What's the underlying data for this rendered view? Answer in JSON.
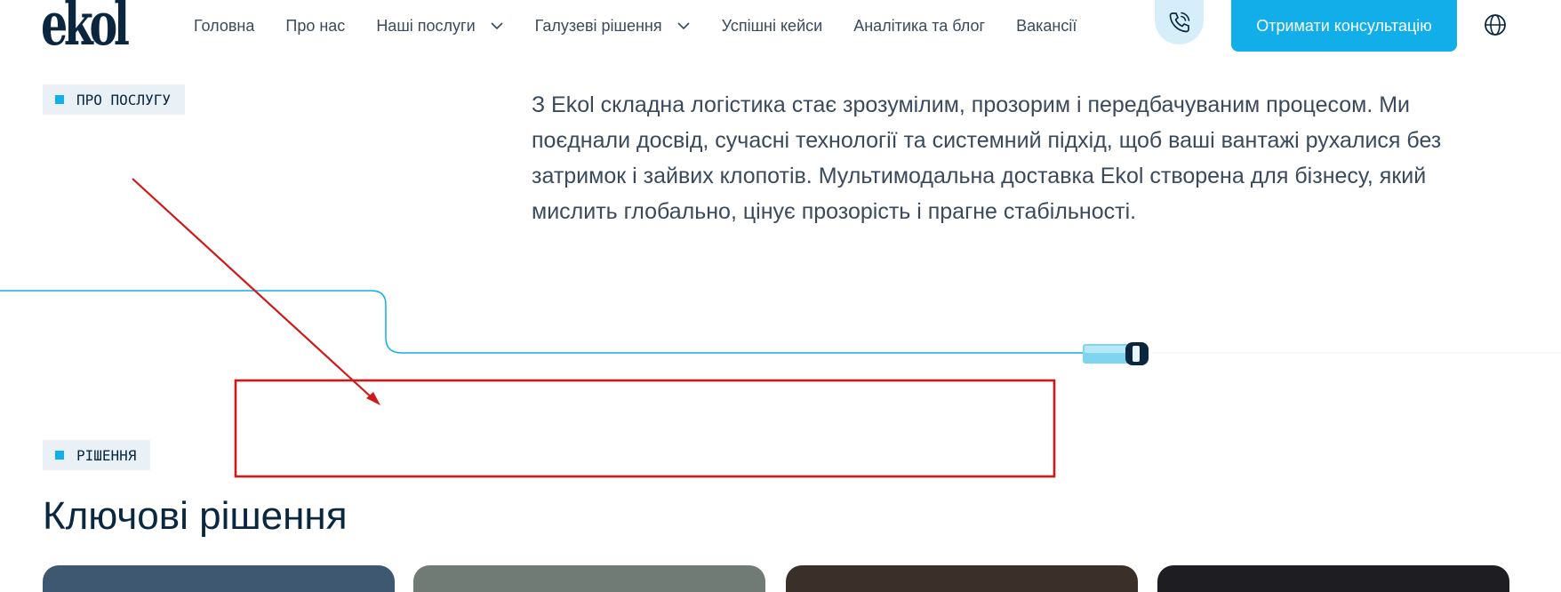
{
  "header": {
    "logo_text": "ekol",
    "nav": [
      {
        "label": "Головна",
        "has_dropdown": false
      },
      {
        "label": "Про нас",
        "has_dropdown": false
      },
      {
        "label": "Наші послуги",
        "has_dropdown": true
      },
      {
        "label": "Галузеві рішення",
        "has_dropdown": true
      },
      {
        "label": "Успішні кейси",
        "has_dropdown": false
      },
      {
        "label": "Аналітика та блог",
        "has_dropdown": false
      },
      {
        "label": "Вакансії",
        "has_dropdown": false
      }
    ],
    "phone_icon": "phone-icon",
    "cta_label": "Отримати консультацію",
    "language_icon": "globe-icon"
  },
  "about": {
    "tag": "ПРО ПОСЛУГУ",
    "text": "З Ekol складна логістика стає зрозумілим, прозорим і передбачуваним процесом. Ми поєднали досвід, сучасні технології та системний підхід, щоб ваші вантажі рухалися без затримок і зайвих клопотів. Мультимодальна доставка Ekol створена для бізнесу, який мислить глобально, цінує прозорість і прагне стабільності."
  },
  "solutions": {
    "tag": "РІШЕННЯ",
    "heading": "Ключові рішення",
    "cards": [
      {
        "name": "card-1",
        "color": "#3f5872"
      },
      {
        "name": "card-2",
        "color": "#6f7b74"
      },
      {
        "name": "card-3",
        "color": "#3b2f2a"
      },
      {
        "name": "card-4",
        "color": "#1e1e22"
      }
    ]
  },
  "colors": {
    "accent": "#12aeea",
    "dark": "#0b2740",
    "annotation": "#d01818"
  }
}
